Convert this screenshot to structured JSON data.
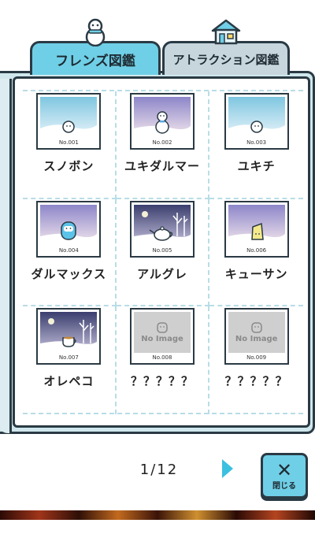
{
  "tabs": [
    {
      "label": "フレンズ図鑑",
      "active": true,
      "icon": "snowman-icon"
    },
    {
      "label": "アトラクション図鑑",
      "active": false,
      "icon": "house-icon"
    }
  ],
  "entries": [
    {
      "no": "No.001",
      "name": "スノボン",
      "scene": "snow-field",
      "character": "small-snowball"
    },
    {
      "no": "No.002",
      "name": "ユキダルマー",
      "scene": "dusk-snow",
      "character": "snowman"
    },
    {
      "no": "No.003",
      "name": "ユキチ",
      "scene": "snow-field",
      "character": "small-snowball"
    },
    {
      "no": "No.004",
      "name": "ダルマックス",
      "scene": "dusk-snow",
      "character": "blue-daruma"
    },
    {
      "no": "No.005",
      "name": "アルグレ",
      "scene": "night-forest",
      "character": "teapot"
    },
    {
      "no": "No.006",
      "name": "キューサン",
      "scene": "dusk-snow",
      "character": "cheese"
    },
    {
      "no": "No.007",
      "name": "オレペコ",
      "scene": "night-forest",
      "character": "teacup"
    },
    {
      "no": "No.008",
      "name": "？？？？？",
      "scene": "no-image",
      "character": "none"
    },
    {
      "no": "No.009",
      "name": "？？？？？",
      "scene": "no-image",
      "character": "none"
    }
  ],
  "no_image_text": "No Image",
  "pager": {
    "text": "1/12",
    "next": "next-arrow-icon"
  },
  "close_button": {
    "label": "閉じる",
    "icon": "close-x-icon"
  },
  "colors": {
    "accent": "#6fcfe6",
    "border": "#2a3a44",
    "grid_line": "#b8dde6",
    "book": "#cfe7ec"
  }
}
